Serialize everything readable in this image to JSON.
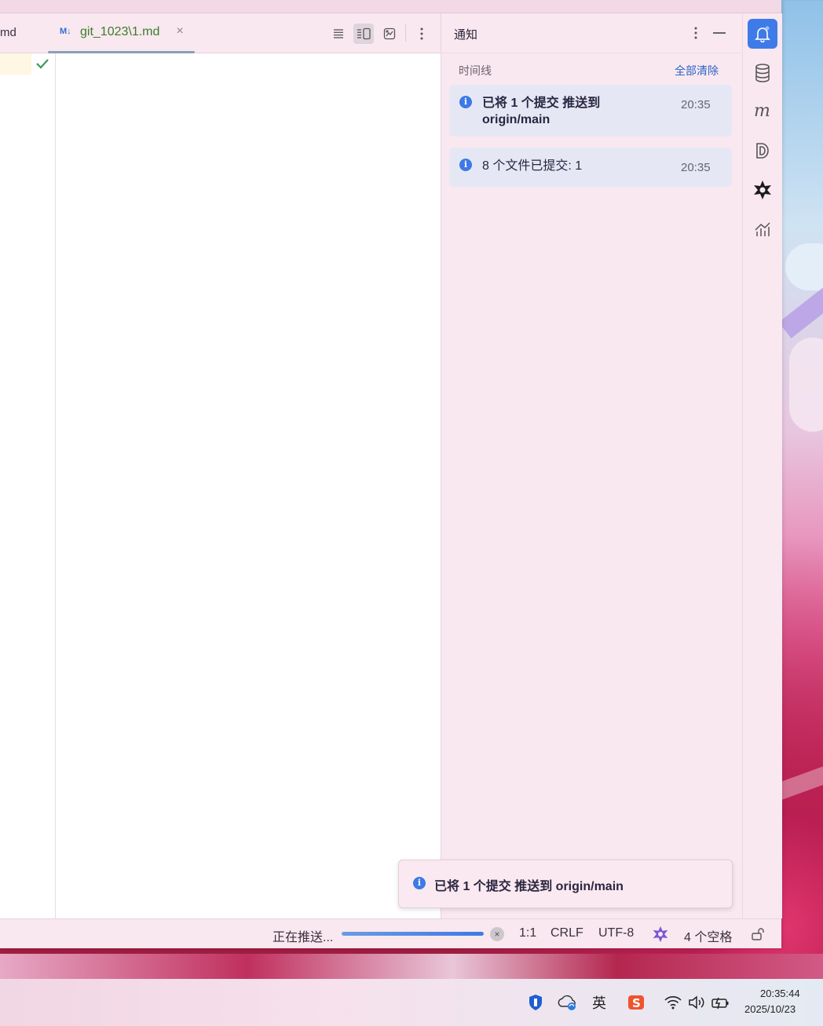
{
  "editor": {
    "prev_tab_label": "md",
    "active_tab": {
      "icon_text": "M↓",
      "label": "git_1023\\1.md",
      "close": "×"
    }
  },
  "notifications": {
    "title": "通知",
    "timeline_label": "时间线",
    "clear_all": "全部清除",
    "items": [
      {
        "text": "已将 1 个提交 推送到 origin/main",
        "time": "20:35",
        "bold": true
      },
      {
        "text": "8 个文件已提交: 1",
        "time": "20:35",
        "bold": false
      }
    ],
    "info_icon_glyph": "i"
  },
  "toast": {
    "text": "已将 1 个提交 推送到 origin/main"
  },
  "statusbar": {
    "progress_label": "正在推送...",
    "progress_cancel": "×",
    "progress_value": 1.0,
    "position": "1:1",
    "line_ending": "CRLF",
    "encoding": "UTF-8",
    "indent": "4 个空格"
  },
  "taskbar": {
    "ime": "英",
    "time": "20:35:44",
    "date": "2025/10/23"
  },
  "colors": {
    "accent": "#3f7be8",
    "panel_bg": "#f9e8ef",
    "card_bg": "#e5e8f4",
    "link": "#2a64c9"
  }
}
